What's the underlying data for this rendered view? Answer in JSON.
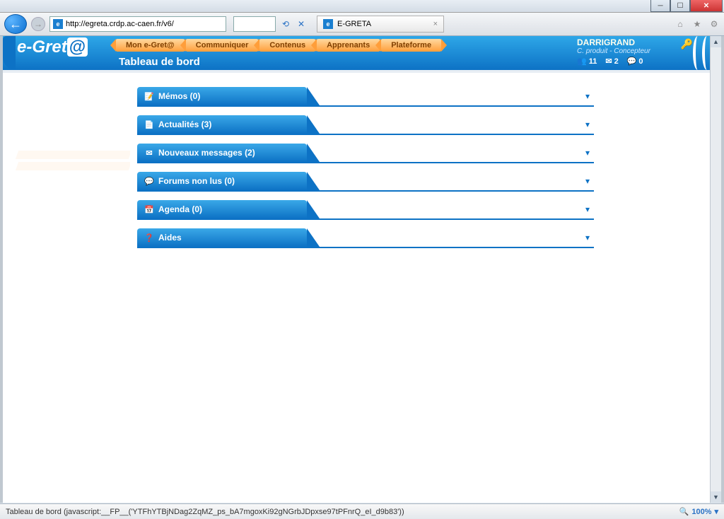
{
  "browser": {
    "url": "http://egreta.crdp.ac-caen.fr/v6/",
    "tab_title": "E-GRETA"
  },
  "app": {
    "logo_text": "e-Gret",
    "logo_at": "@",
    "subtitle": "Tableau de bord"
  },
  "nav": [
    {
      "label": "Mon e-Gret@"
    },
    {
      "label": "Communiquer"
    },
    {
      "label": "Contenus"
    },
    {
      "label": "Apprenants"
    },
    {
      "label": "Plateforme"
    }
  ],
  "user": {
    "name": "DARRIGRAND",
    "role": "C. produit - Concepteur",
    "stats": {
      "users": "11",
      "mail": "2",
      "chat": "0"
    }
  },
  "panels": [
    {
      "icon": "📝",
      "label": "Mémos (0)"
    },
    {
      "icon": "📄",
      "label": "Actualités (3)"
    },
    {
      "icon": "✉",
      "label": "Nouveaux messages (2)"
    },
    {
      "icon": "💬",
      "label": "Forums non lus (0)"
    },
    {
      "icon": "📅",
      "label": "Agenda (0)"
    },
    {
      "icon": "❓",
      "label": "Aides"
    }
  ],
  "status": {
    "text": "Tableau de bord (javascript:__FP__('YTFhYTBjNDag2ZqMZ_ps_bA7mgoxKi92gNGrbJDpxse97tPFnrQ_eI_d9b83'))",
    "zoom": "100%"
  }
}
